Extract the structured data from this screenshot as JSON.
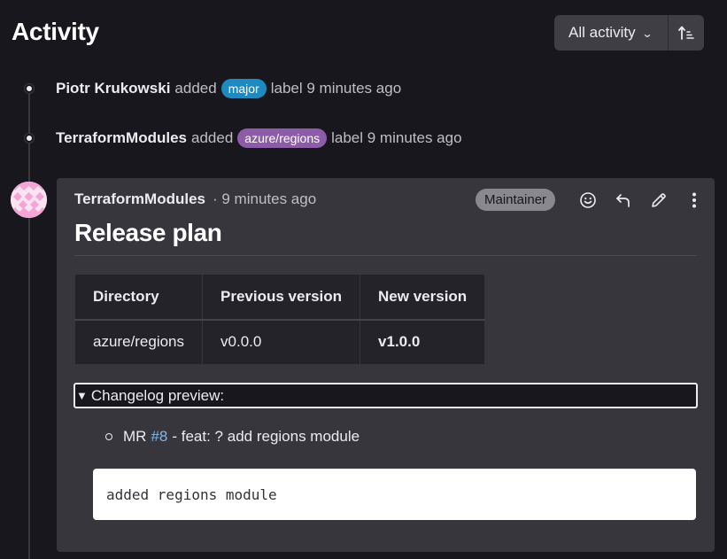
{
  "header": {
    "title": "Activity",
    "filter_label": "All activity",
    "filter_icon": "chevron-down-icon",
    "sort_icon": "sort-ascending-icon"
  },
  "events": [
    {
      "author": "Piotr Krukowski",
      "action": "added",
      "label": "major",
      "label_color": "#1f8ac0",
      "suffix": "label 9 minutes ago"
    },
    {
      "author": "TerraformModules",
      "action": "added",
      "label": "azure/regions",
      "label_color": "#8d5ca8",
      "suffix": "label 9 minutes ago"
    }
  ],
  "comment": {
    "author": "TerraformModules",
    "time": "· 9 minutes ago",
    "role": "Maintainer",
    "actions": [
      "add-reaction",
      "reply",
      "edit",
      "more-actions"
    ],
    "title": "Release plan",
    "table": {
      "headers": [
        "Directory",
        "Previous version",
        "New version"
      ],
      "rows": [
        [
          "azure/regions",
          "v0.0.0",
          "v1.0.0"
        ]
      ]
    },
    "details_summary": "Changelog preview:",
    "changelog": {
      "prefix": "MR",
      "link": "#8",
      "text": "- feat: ? add regions module"
    },
    "code": "added regions module"
  }
}
